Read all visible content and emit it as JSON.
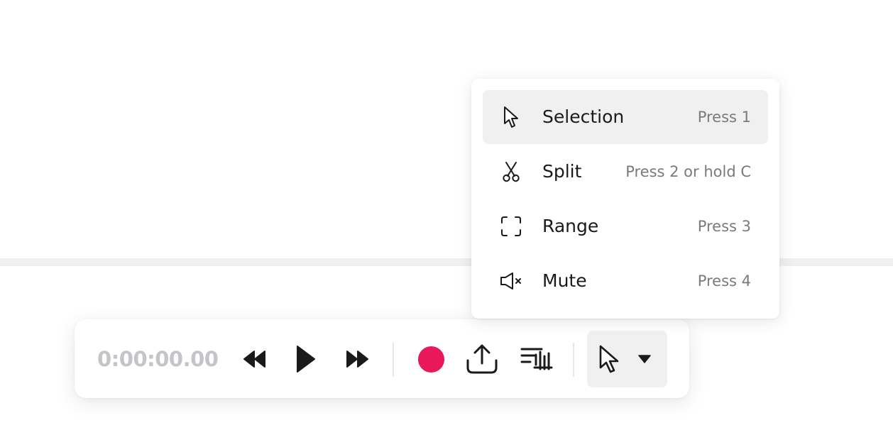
{
  "toolbar": {
    "timecode": "0:00:00.00",
    "buttons": {
      "rewind": "rewind-icon",
      "play": "play-icon",
      "fast_forward": "fast-forward-icon",
      "record": "record-icon",
      "export": "upload-icon",
      "waveform": "transcript-waveform-icon",
      "tool_selector": "pointer-icon",
      "tool_dropdown": "caret-down-icon"
    },
    "record_color": "#e8185a",
    "timecode_color": "#c4c4c9"
  },
  "tool_menu": {
    "items": [
      {
        "label": "Selection",
        "hint": "Press 1",
        "icon": "pointer-icon",
        "active": true
      },
      {
        "label": "Split",
        "hint": "Press 2 or hold C",
        "icon": "scissors-icon",
        "active": false
      },
      {
        "label": "Range",
        "hint": "Press 3",
        "icon": "range-bracket-icon",
        "active": false
      },
      {
        "label": "Mute",
        "hint": "Press 4",
        "icon": "mute-speaker-icon",
        "active": false
      }
    ]
  }
}
